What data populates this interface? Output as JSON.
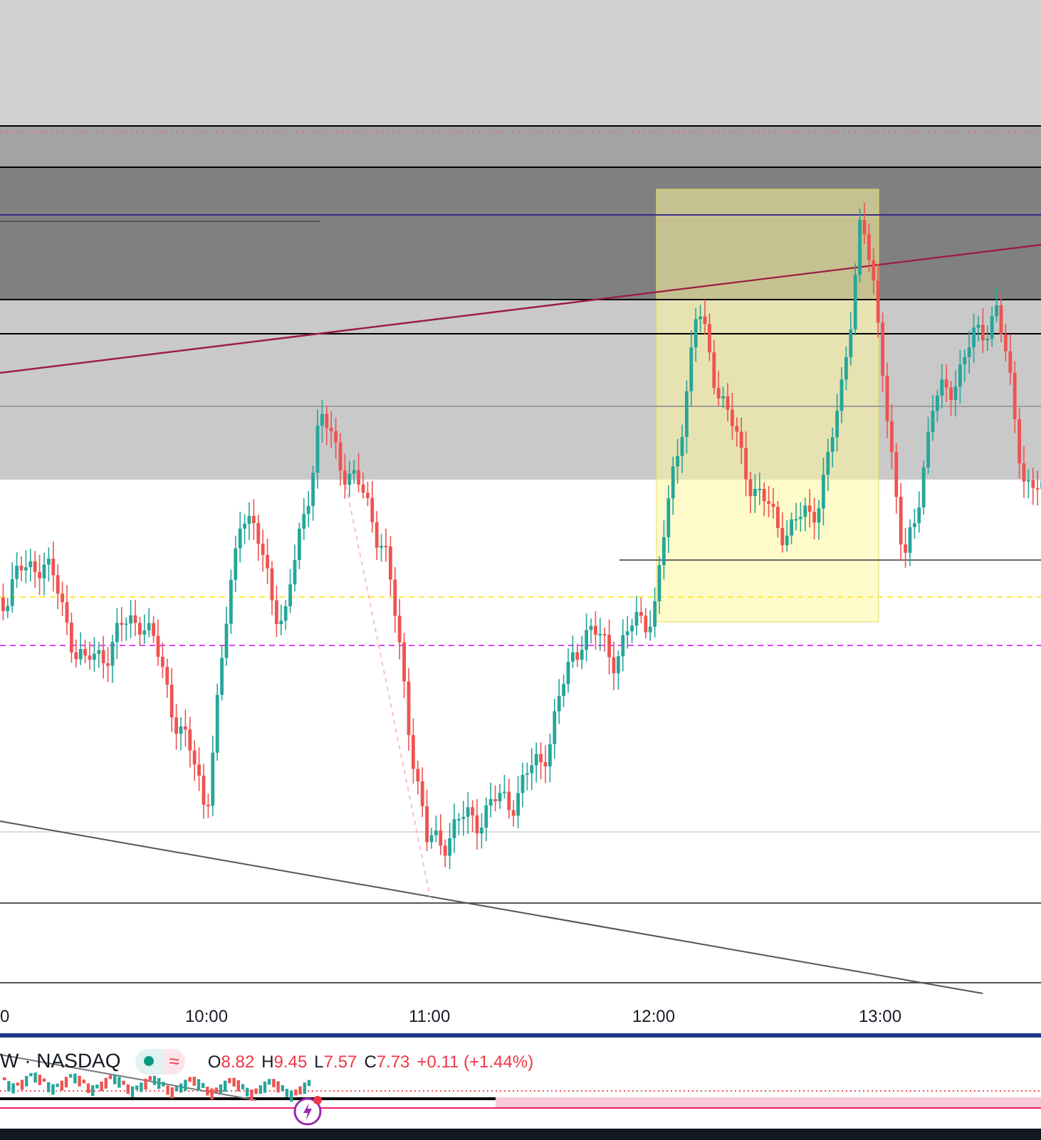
{
  "time_axis": {
    "labels": [
      "0",
      "10:00",
      "11:00",
      "12:00",
      "13:00"
    ]
  },
  "legend": {
    "symbol": "W · NASDAQ",
    "status_glyph": "≈",
    "ohlc": [
      {
        "label": "O",
        "value": "8.82"
      },
      {
        "label": "H",
        "value": "9.45"
      },
      {
        "label": "L",
        "value": "7.57"
      },
      {
        "label": "C",
        "value": "7.73"
      }
    ],
    "change": "+0.11 (+1.44%)"
  }
}
